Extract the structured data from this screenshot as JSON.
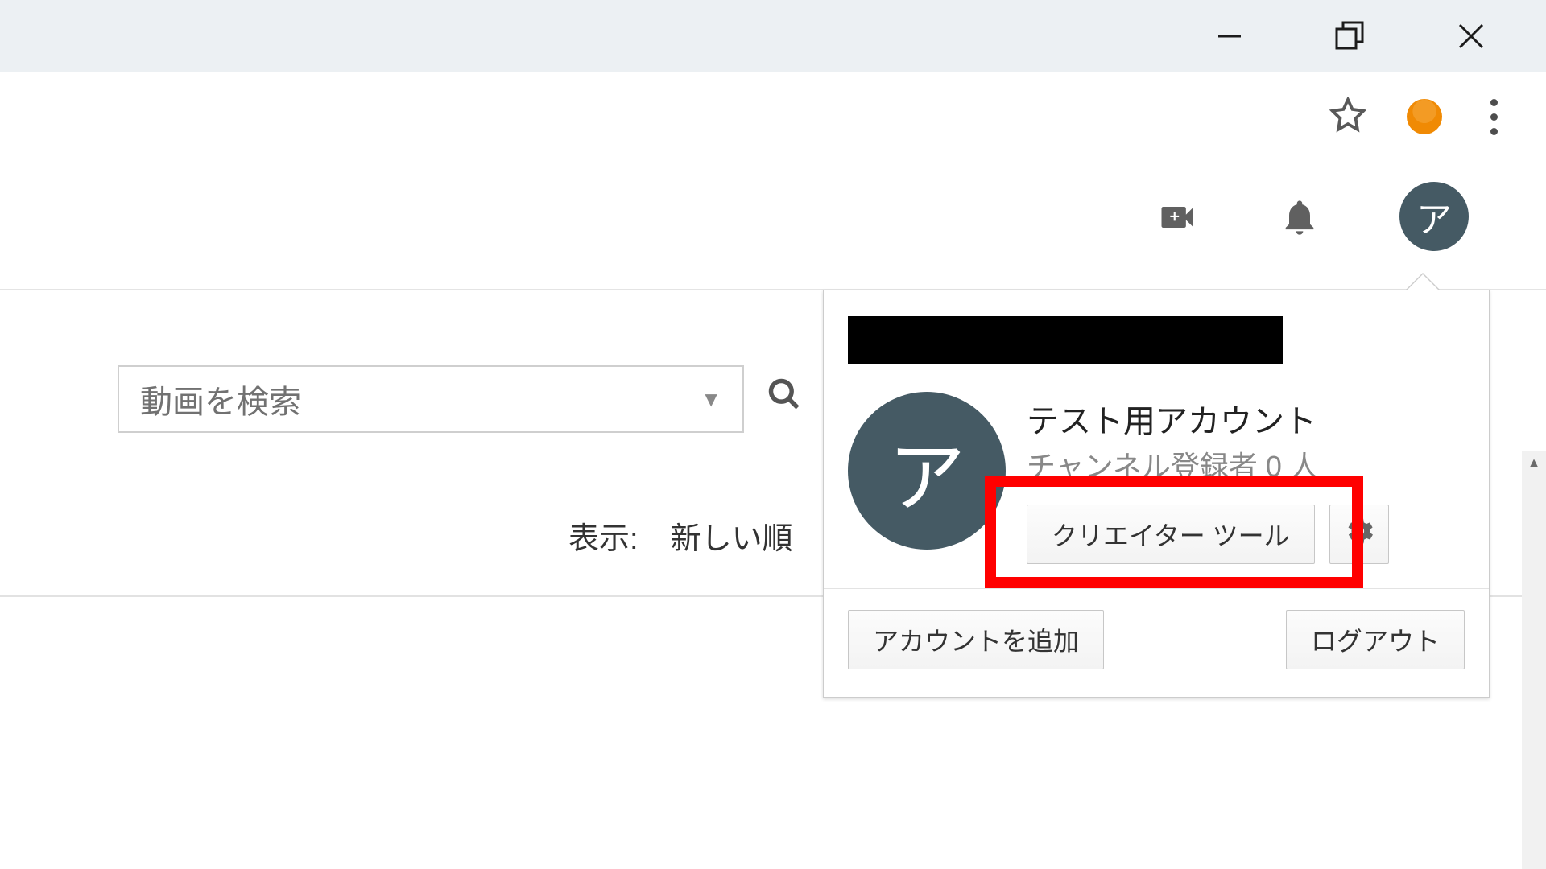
{
  "avatar_letter": "ア",
  "search": {
    "placeholder": "動画を検索"
  },
  "sort": {
    "label": "表示:",
    "value": "新しい順"
  },
  "popup": {
    "account_name": "テスト用アカウント",
    "subscribers": "チャンネル登録者 0 人",
    "creator_button": "クリエイター ツール",
    "add_account": "アカウントを追加",
    "logout": "ログアウト"
  }
}
